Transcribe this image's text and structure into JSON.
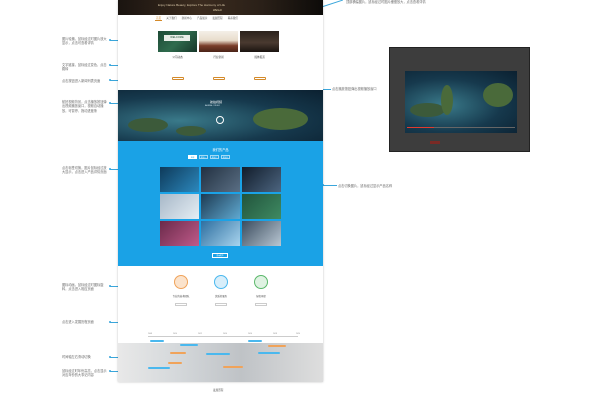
{
  "colors": {
    "accent": "#3aa6db",
    "orange": "#d48a2a",
    "blue_section": "#1aa2e6",
    "player_bg": "#3d3d3d"
  },
  "left_notes": [
    "图片轮播，鼠标经过时图片放大显示，点击可查看详情",
    "文字链接，鼠标经过变色，点击跳转",
    "点击按钮进入新闻列表页面",
    "航拍视频背景，点击播放按钮弹出视频播放窗口，视频自动播放，可暂停、拖动进度条",
    "点击标签切换，图片鼠标经过放大显示，点击进入产品详情页面",
    "图标动画，鼠标经过时图标旋转，点击进入相应页面",
    "点击进入发展历程页面",
    "时间轴左右滑动切换",
    "鼠标经过时年份高亮，点击显示对应年份的大事记内容"
  ],
  "right_notes": [
    "顶部横幅图片，鼠标经过时图片缓慢放大，点击查看详情",
    "点击播放按钮弹出视频播放窗口",
    "点击切换图片，鼠标经过显示产品名称"
  ],
  "banner": {
    "text": "Enjoy Nature Beauty, Explore The Harmony of Life",
    "logo": "WEILAI"
  },
  "nav": [
    "首页",
    "关于我们",
    "新闻中心",
    "产品展示",
    "发展历程",
    "联系我们"
  ],
  "photos": [
    {
      "caption": "公司动态",
      "sign": "WELCOME"
    },
    {
      "caption": "行业新闻"
    },
    {
      "caption": "媒体报道"
    }
  ],
  "aerial": {
    "title": "航拍视频",
    "subtitle": "AERIAL VIDEO"
  },
  "products": {
    "title": "我们的产品",
    "tabs": [
      "全部",
      "类别一",
      "类别二",
      "类别三"
    ],
    "more": "查看更多"
  },
  "features": [
    {
      "title": "专业的技术团队",
      "color": "#f0a35a"
    },
    {
      "title": "优质的服务",
      "color": "#4ab8ee"
    },
    {
      "title": "绿色环保",
      "color": "#5ab86a"
    }
  ],
  "timeline": {
    "years": [
      "2008",
      "2010",
      "2012",
      "2014",
      "2016",
      "2018",
      "2020"
    ]
  },
  "footer": "发展历程"
}
